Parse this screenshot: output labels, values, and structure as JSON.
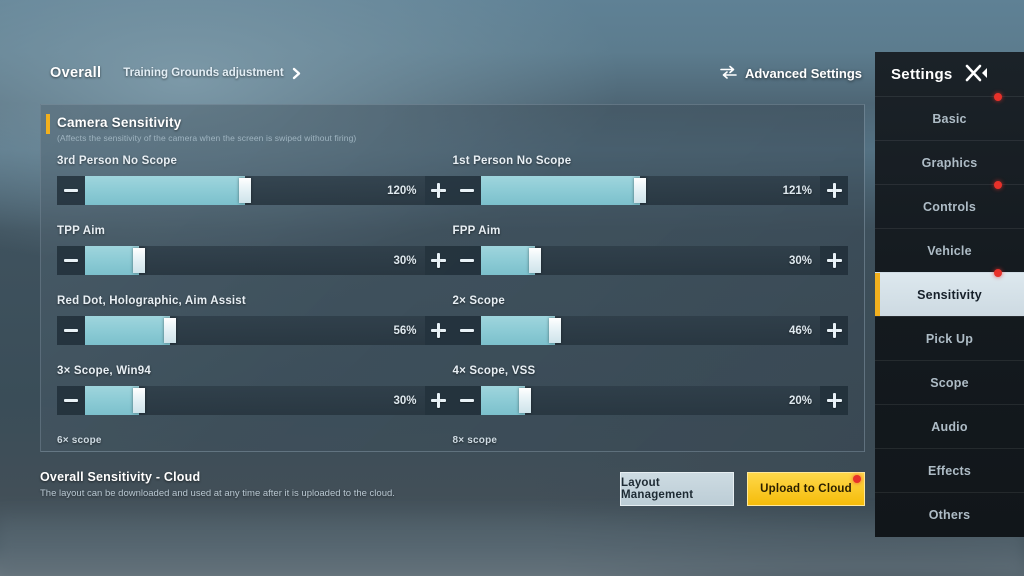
{
  "theme": {
    "accent_yellow": "#f2b01e",
    "slider_fill": "#8ccbd5",
    "panel_bg": "#3f505c",
    "sidebar_bg": "#141a1f",
    "notification_dot": "#e8312a",
    "upload_button": "#f5bc0a",
    "layout_button": "#cddbe2"
  },
  "topbar": {
    "overall_tab": "Overall",
    "training_link": "Training Grounds adjustment",
    "advanced_settings": "Advanced Settings",
    "chevron_icon": "chevron-right-icon",
    "advanced_icon": "swap-arrows-icon"
  },
  "panel": {
    "section_title": "Camera Sensitivity",
    "section_subtitle": "(Affects the sensitivity of the camera when the screen is swiped without firing)",
    "minus_label": "−",
    "plus_label": "+",
    "rows": [
      {
        "label": "3rd Person No Scope",
        "value": "120%",
        "percent": 47
      },
      {
        "label": "1st Person No Scope",
        "value": "121%",
        "percent": 47
      },
      {
        "label": "TPP Aim",
        "value": "30%",
        "percent": 16
      },
      {
        "label": "FPP Aim",
        "value": "30%",
        "percent": 16
      },
      {
        "label": "Red Dot, Holographic, Aim Assist",
        "value": "56%",
        "percent": 25
      },
      {
        "label": "2× Scope",
        "value": "46%",
        "percent": 22
      },
      {
        "label": "3× Scope, Win94",
        "value": "30%",
        "percent": 16
      },
      {
        "label": "4× Scope, VSS",
        "value": "20%",
        "percent": 13
      }
    ],
    "tail_rows": [
      {
        "label": "6× scope"
      },
      {
        "label": "8× scope"
      }
    ]
  },
  "bottom": {
    "cloud_title": "Overall Sensitivity - Cloud",
    "cloud_description": "The layout can be downloaded and used at any time after it is uploaded to the cloud.",
    "layout_button": "Layout Management",
    "upload_button": "Upload to Cloud"
  },
  "sidebar": {
    "title": "Settings",
    "close_icon": "close-icon",
    "items": [
      {
        "label": "Basic",
        "active": false,
        "dot": true
      },
      {
        "label": "Graphics",
        "active": false,
        "dot": false
      },
      {
        "label": "Controls",
        "active": false,
        "dot": true
      },
      {
        "label": "Vehicle",
        "active": false,
        "dot": false
      },
      {
        "label": "Sensitivity",
        "active": true,
        "dot": true
      },
      {
        "label": "Pick Up",
        "active": false,
        "dot": false
      },
      {
        "label": "Scope",
        "active": false,
        "dot": false
      },
      {
        "label": "Audio",
        "active": false,
        "dot": false
      },
      {
        "label": "Effects",
        "active": false,
        "dot": false
      },
      {
        "label": "Others",
        "active": false,
        "dot": false
      }
    ]
  }
}
